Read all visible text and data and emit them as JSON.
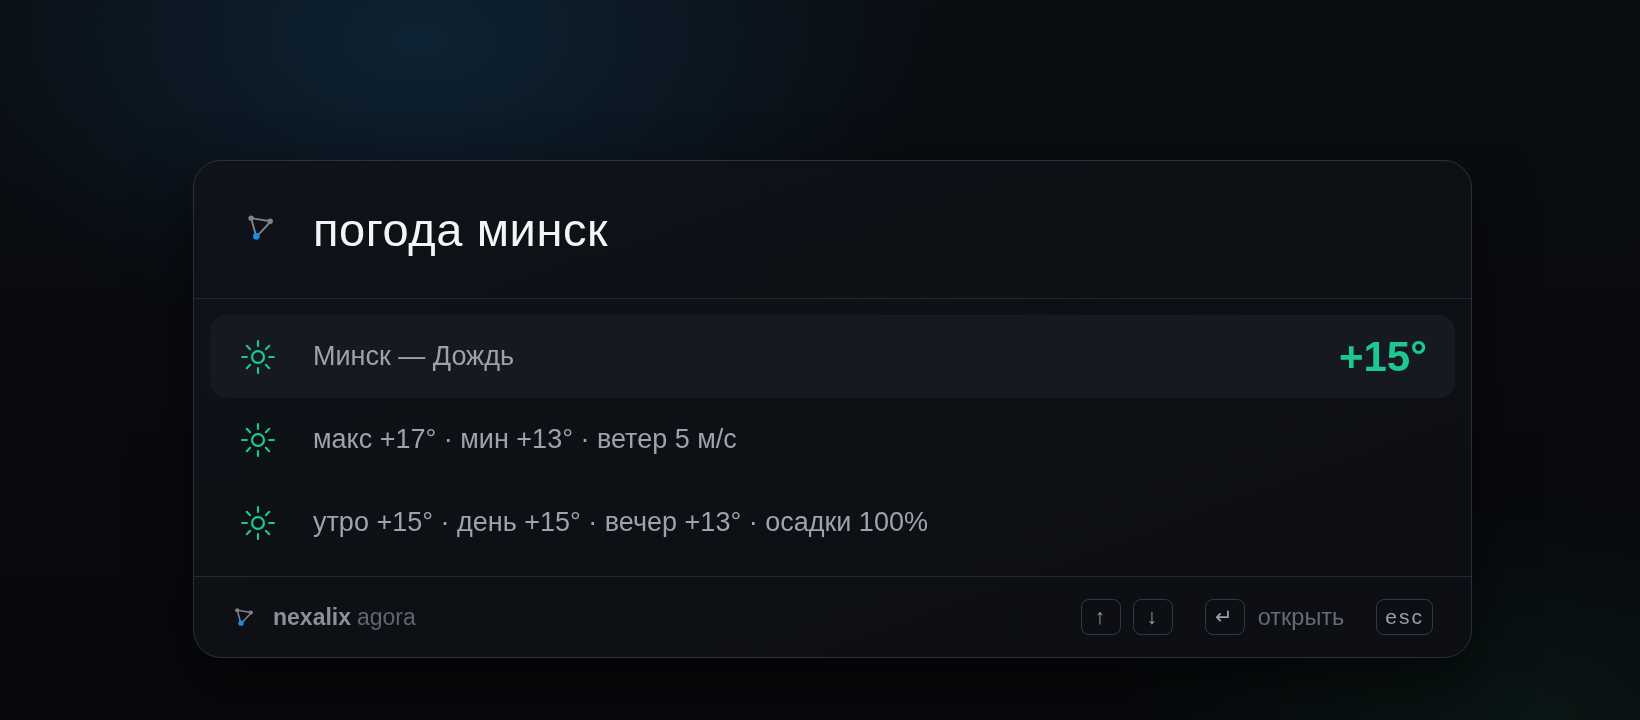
{
  "search": {
    "value": "погода минск"
  },
  "results": [
    {
      "text": "Минск — Дождь",
      "temperature": "+15°",
      "selected": true
    },
    {
      "text": "макс +17° · мин +13° · ветер 5 м/с",
      "selected": false
    },
    {
      "text": "утро +15° · день +15° · вечер +13° · осадки 100%",
      "selected": false
    }
  ],
  "footer": {
    "brand": "nexalix",
    "product": "agora",
    "shortcuts": [
      {
        "keys": [
          "↑",
          "↓"
        ]
      },
      {
        "keys": [
          "↵"
        ],
        "label": "открыть"
      },
      {
        "keys": [
          "esc"
        ]
      }
    ]
  }
}
